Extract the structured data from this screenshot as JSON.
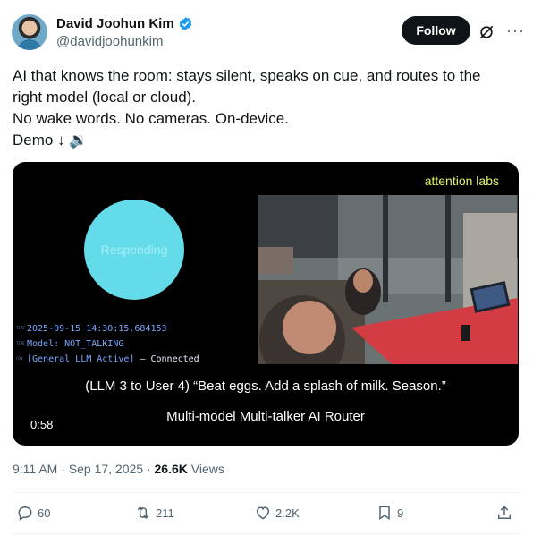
{
  "author": {
    "display_name": "David Joohun Kim",
    "handle": "@davidjoohunkim"
  },
  "follow_label": "Follow",
  "tweet": {
    "lines": [
      "AI that knows the room: stays silent, speaks on cue, and routes to the",
      "right model (local or cloud).",
      "No wake words. No cameras. On-device.",
      "Demo ↓ 🔉"
    ]
  },
  "video": {
    "brand": "attention labs",
    "orb_label": "Responding",
    "terminal": {
      "line1": "2025-09-15 14:30:15.684153",
      "line2": "Model: NOT_TALKING",
      "line3_a": "[General LLM Active]",
      "line3_b": " – Connected",
      "tag1": "TIME",
      "tag2": "TIME",
      "tag3": "CON"
    },
    "caption": "(LLM 3 to User 4) “Beat eggs. Add a splash of milk. Season.”",
    "subtitle": "Multi-model Multi-talker AI Router",
    "duration": "0:58"
  },
  "meta": {
    "time_date": "9:11 AM · Sep 17, 2025 · ",
    "views_count": "26.6K",
    "views_label": " Views"
  },
  "actions": {
    "replies": "60",
    "reposts": "211",
    "likes": "2.2K",
    "bookmarks": "9"
  }
}
